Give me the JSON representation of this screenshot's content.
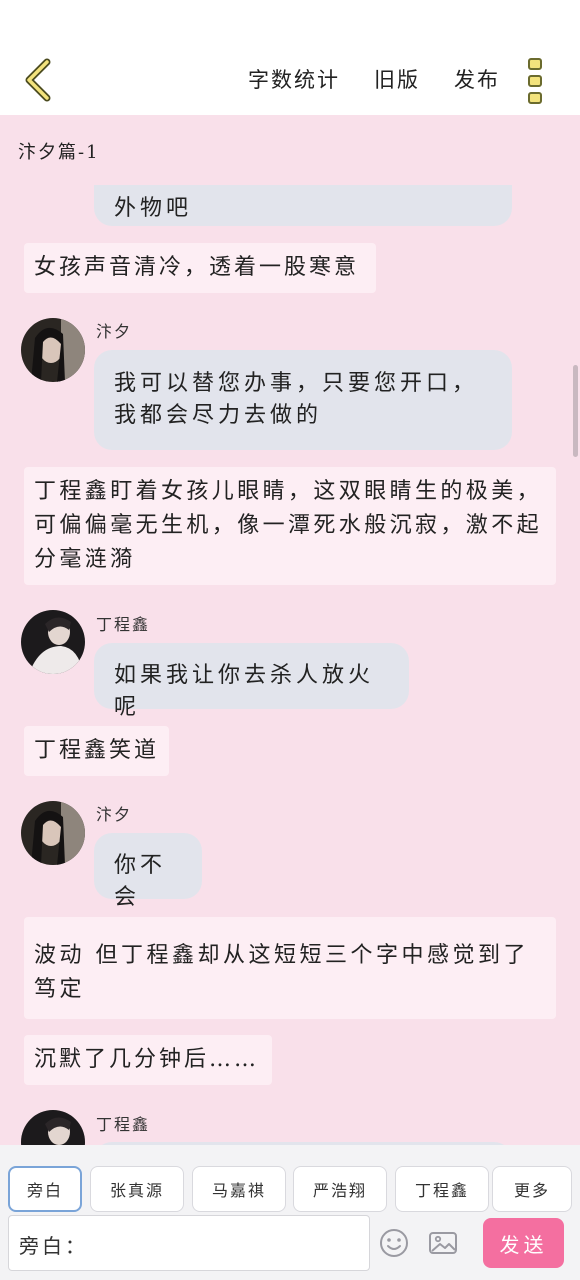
{
  "header": {
    "actions": [
      "字数统计",
      "旧版",
      "发布"
    ]
  },
  "chapter": {
    "title": "汴夕篇-1"
  },
  "messages": {
    "m0": {
      "text": "外物吧"
    },
    "m1": {
      "text": "女孩声音清冷，透着一股寒意"
    },
    "m2": {
      "name": "汴夕",
      "text": "我可以替您办事，只要您开口，我都会尽力去做的"
    },
    "m3": {
      "text": "丁程鑫盯着女孩儿眼睛，这双眼睛生的极美，可偏偏毫无生机，像一潭死水般沉寂，激不起分毫涟漪"
    },
    "m4": {
      "name": "丁程鑫",
      "text": "如果我让你去杀人放火呢"
    },
    "m5": {
      "text": "丁程鑫笑道"
    },
    "m6": {
      "name": "汴夕",
      "text": "你不会"
    },
    "m7": {
      "text": "波动 但丁程鑫却从这短短三个字中感觉到了笃定"
    },
    "m8": {
      "text": "沉默了几分钟后……"
    },
    "m9": {
      "name": "丁程鑫"
    }
  },
  "roles": [
    "旁白",
    "张真源",
    "马嘉祺",
    "严浩翔",
    "丁程鑫",
    "更多"
  ],
  "composer": {
    "prefix": "旁白：",
    "send_label": "发送"
  },
  "colors": {
    "background": "#f9e0ea",
    "bubble": "#e2e4ec",
    "narration": "#fdeef4",
    "send": "#f46fa0",
    "active_tab_border": "#7aa4d8"
  }
}
